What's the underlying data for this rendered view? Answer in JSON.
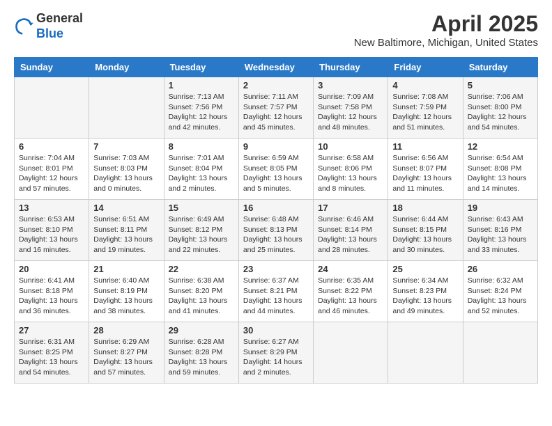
{
  "logo": {
    "general": "General",
    "blue": "Blue"
  },
  "header": {
    "month": "April 2025",
    "location": "New Baltimore, Michigan, United States"
  },
  "weekdays": [
    "Sunday",
    "Monday",
    "Tuesday",
    "Wednesday",
    "Thursday",
    "Friday",
    "Saturday"
  ],
  "weeks": [
    [
      {
        "day": "",
        "sunrise": "",
        "sunset": "",
        "daylight": ""
      },
      {
        "day": "",
        "sunrise": "",
        "sunset": "",
        "daylight": ""
      },
      {
        "day": "1",
        "sunrise": "Sunrise: 7:13 AM",
        "sunset": "Sunset: 7:56 PM",
        "daylight": "Daylight: 12 hours and 42 minutes."
      },
      {
        "day": "2",
        "sunrise": "Sunrise: 7:11 AM",
        "sunset": "Sunset: 7:57 PM",
        "daylight": "Daylight: 12 hours and 45 minutes."
      },
      {
        "day": "3",
        "sunrise": "Sunrise: 7:09 AM",
        "sunset": "Sunset: 7:58 PM",
        "daylight": "Daylight: 12 hours and 48 minutes."
      },
      {
        "day": "4",
        "sunrise": "Sunrise: 7:08 AM",
        "sunset": "Sunset: 7:59 PM",
        "daylight": "Daylight: 12 hours and 51 minutes."
      },
      {
        "day": "5",
        "sunrise": "Sunrise: 7:06 AM",
        "sunset": "Sunset: 8:00 PM",
        "daylight": "Daylight: 12 hours and 54 minutes."
      }
    ],
    [
      {
        "day": "6",
        "sunrise": "Sunrise: 7:04 AM",
        "sunset": "Sunset: 8:01 PM",
        "daylight": "Daylight: 12 hours and 57 minutes."
      },
      {
        "day": "7",
        "sunrise": "Sunrise: 7:03 AM",
        "sunset": "Sunset: 8:03 PM",
        "daylight": "Daylight: 13 hours and 0 minutes."
      },
      {
        "day": "8",
        "sunrise": "Sunrise: 7:01 AM",
        "sunset": "Sunset: 8:04 PM",
        "daylight": "Daylight: 13 hours and 2 minutes."
      },
      {
        "day": "9",
        "sunrise": "Sunrise: 6:59 AM",
        "sunset": "Sunset: 8:05 PM",
        "daylight": "Daylight: 13 hours and 5 minutes."
      },
      {
        "day": "10",
        "sunrise": "Sunrise: 6:58 AM",
        "sunset": "Sunset: 8:06 PM",
        "daylight": "Daylight: 13 hours and 8 minutes."
      },
      {
        "day": "11",
        "sunrise": "Sunrise: 6:56 AM",
        "sunset": "Sunset: 8:07 PM",
        "daylight": "Daylight: 13 hours and 11 minutes."
      },
      {
        "day": "12",
        "sunrise": "Sunrise: 6:54 AM",
        "sunset": "Sunset: 8:08 PM",
        "daylight": "Daylight: 13 hours and 14 minutes."
      }
    ],
    [
      {
        "day": "13",
        "sunrise": "Sunrise: 6:53 AM",
        "sunset": "Sunset: 8:10 PM",
        "daylight": "Daylight: 13 hours and 16 minutes."
      },
      {
        "day": "14",
        "sunrise": "Sunrise: 6:51 AM",
        "sunset": "Sunset: 8:11 PM",
        "daylight": "Daylight: 13 hours and 19 minutes."
      },
      {
        "day": "15",
        "sunrise": "Sunrise: 6:49 AM",
        "sunset": "Sunset: 8:12 PM",
        "daylight": "Daylight: 13 hours and 22 minutes."
      },
      {
        "day": "16",
        "sunrise": "Sunrise: 6:48 AM",
        "sunset": "Sunset: 8:13 PM",
        "daylight": "Daylight: 13 hours and 25 minutes."
      },
      {
        "day": "17",
        "sunrise": "Sunrise: 6:46 AM",
        "sunset": "Sunset: 8:14 PM",
        "daylight": "Daylight: 13 hours and 28 minutes."
      },
      {
        "day": "18",
        "sunrise": "Sunrise: 6:44 AM",
        "sunset": "Sunset: 8:15 PM",
        "daylight": "Daylight: 13 hours and 30 minutes."
      },
      {
        "day": "19",
        "sunrise": "Sunrise: 6:43 AM",
        "sunset": "Sunset: 8:16 PM",
        "daylight": "Daylight: 13 hours and 33 minutes."
      }
    ],
    [
      {
        "day": "20",
        "sunrise": "Sunrise: 6:41 AM",
        "sunset": "Sunset: 8:18 PM",
        "daylight": "Daylight: 13 hours and 36 minutes."
      },
      {
        "day": "21",
        "sunrise": "Sunrise: 6:40 AM",
        "sunset": "Sunset: 8:19 PM",
        "daylight": "Daylight: 13 hours and 38 minutes."
      },
      {
        "day": "22",
        "sunrise": "Sunrise: 6:38 AM",
        "sunset": "Sunset: 8:20 PM",
        "daylight": "Daylight: 13 hours and 41 minutes."
      },
      {
        "day": "23",
        "sunrise": "Sunrise: 6:37 AM",
        "sunset": "Sunset: 8:21 PM",
        "daylight": "Daylight: 13 hours and 44 minutes."
      },
      {
        "day": "24",
        "sunrise": "Sunrise: 6:35 AM",
        "sunset": "Sunset: 8:22 PM",
        "daylight": "Daylight: 13 hours and 46 minutes."
      },
      {
        "day": "25",
        "sunrise": "Sunrise: 6:34 AM",
        "sunset": "Sunset: 8:23 PM",
        "daylight": "Daylight: 13 hours and 49 minutes."
      },
      {
        "day": "26",
        "sunrise": "Sunrise: 6:32 AM",
        "sunset": "Sunset: 8:24 PM",
        "daylight": "Daylight: 13 hours and 52 minutes."
      }
    ],
    [
      {
        "day": "27",
        "sunrise": "Sunrise: 6:31 AM",
        "sunset": "Sunset: 8:25 PM",
        "daylight": "Daylight: 13 hours and 54 minutes."
      },
      {
        "day": "28",
        "sunrise": "Sunrise: 6:29 AM",
        "sunset": "Sunset: 8:27 PM",
        "daylight": "Daylight: 13 hours and 57 minutes."
      },
      {
        "day": "29",
        "sunrise": "Sunrise: 6:28 AM",
        "sunset": "Sunset: 8:28 PM",
        "daylight": "Daylight: 13 hours and 59 minutes."
      },
      {
        "day": "30",
        "sunrise": "Sunrise: 6:27 AM",
        "sunset": "Sunset: 8:29 PM",
        "daylight": "Daylight: 14 hours and 2 minutes."
      },
      {
        "day": "",
        "sunrise": "",
        "sunset": "",
        "daylight": ""
      },
      {
        "day": "",
        "sunrise": "",
        "sunset": "",
        "daylight": ""
      },
      {
        "day": "",
        "sunrise": "",
        "sunset": "",
        "daylight": ""
      }
    ]
  ]
}
